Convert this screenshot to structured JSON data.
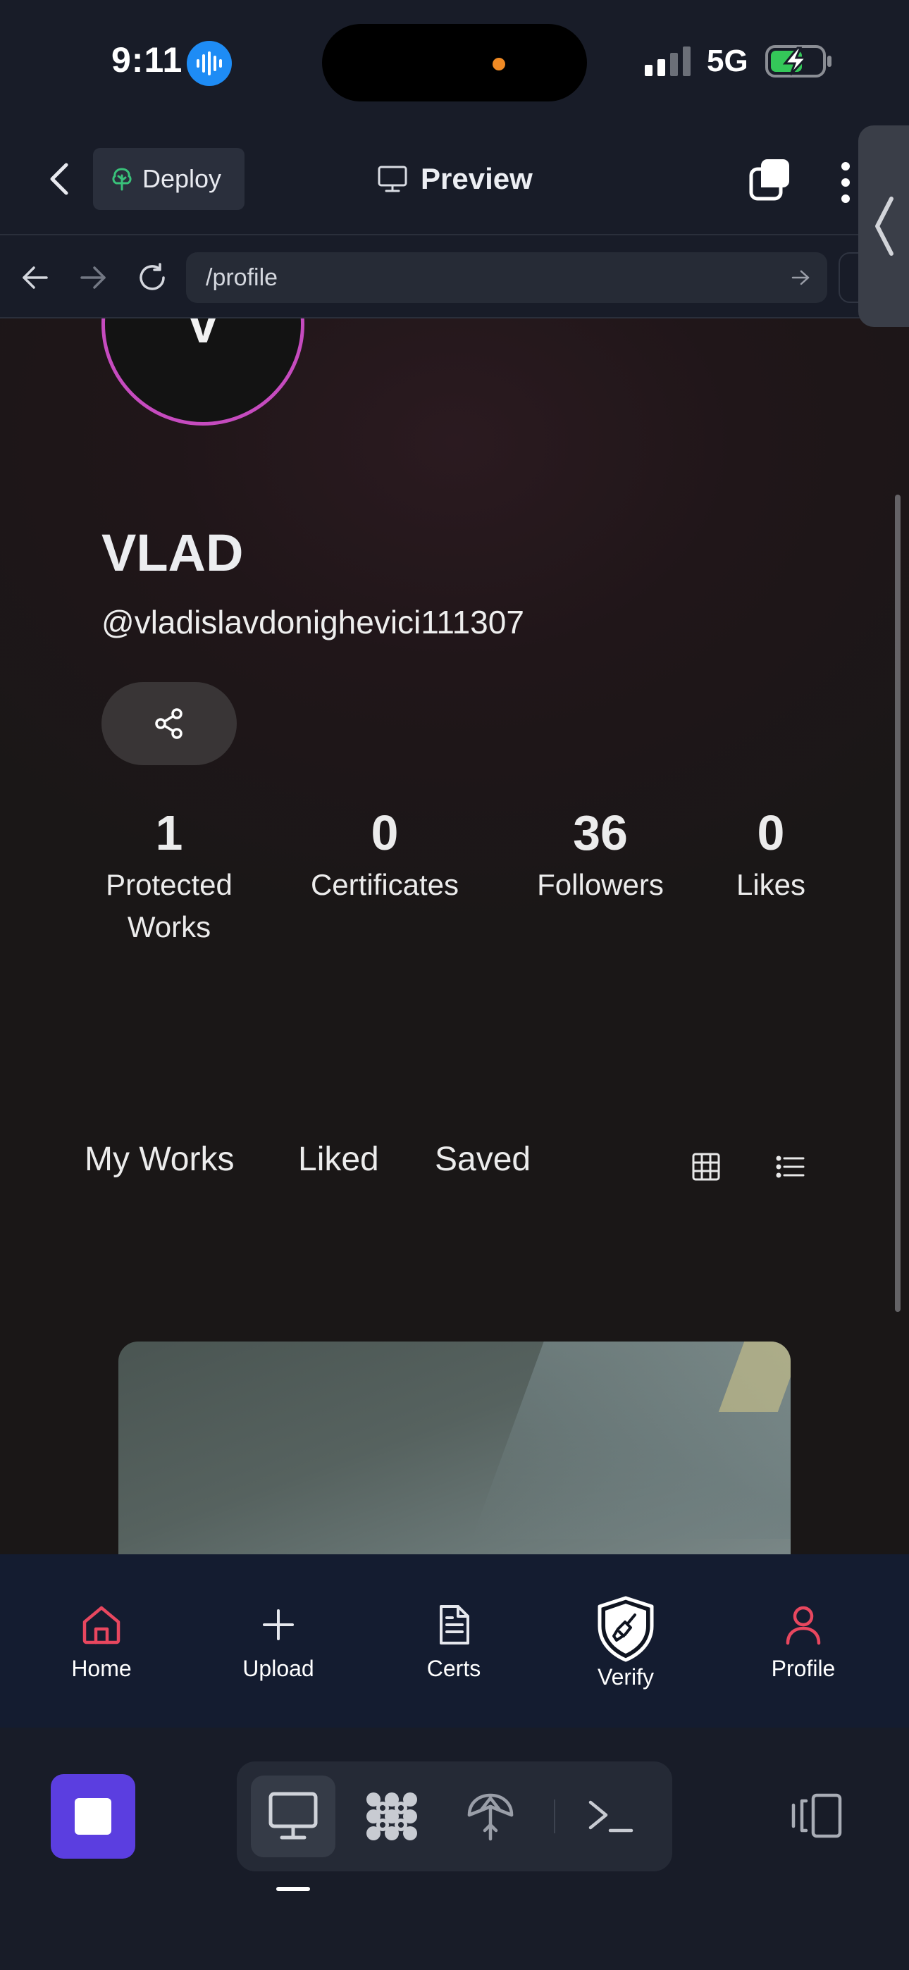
{
  "status_bar": {
    "time": "9:11",
    "network": "5G",
    "mic_icon": "waveform-icon",
    "battery_icon": "battery-charging-icon"
  },
  "header": {
    "deploy_label": "Deploy",
    "preview_label": "Preview",
    "icons": [
      "chevron-left-icon",
      "tree-icon",
      "monitor-icon",
      "copy-icon",
      "more-vertical-icon",
      "chevron-left-icon"
    ]
  },
  "url_bar": {
    "path": "/profile",
    "icons": [
      "arrow-left-icon",
      "arrow-right-icon",
      "refresh-icon",
      "arrow-right-icon"
    ]
  },
  "profile": {
    "avatar_initial": "V",
    "name": "VLAD",
    "handle": "@vladislavdonighevici111307",
    "share_icon": "share-icon",
    "avatar_ring_color": "#c64bbf",
    "stats": [
      {
        "value": "1",
        "label_line1": "Protected",
        "label_line2": "Works"
      },
      {
        "value": "0",
        "label_line1": "Certificates",
        "label_line2": ""
      },
      {
        "value": "36",
        "label_line1": "Followers",
        "label_line2": ""
      },
      {
        "value": "0",
        "label_line1": "Likes",
        "label_line2": ""
      }
    ],
    "tabs": [
      "My Works",
      "Liked",
      "Saved"
    ],
    "view_icons": [
      "grid-icon",
      "list-icon"
    ]
  },
  "app_nav": {
    "accent_color": "#e8475f",
    "items": [
      {
        "label": "Home",
        "icon": "home-icon"
      },
      {
        "label": "Upload",
        "icon": "plus-icon"
      },
      {
        "label": "Certs",
        "icon": "document-icon"
      },
      {
        "label": "Verify",
        "icon": "shield-brush-icon"
      },
      {
        "label": "Profile",
        "icon": "user-icon"
      }
    ]
  },
  "system_toolbar": {
    "accent_color": "#5b3ee0",
    "icons": [
      "stop-icon",
      "monitor-icon",
      "flower-icon",
      "umbrella-icon",
      "terminal-icon",
      "panels-icon"
    ]
  }
}
